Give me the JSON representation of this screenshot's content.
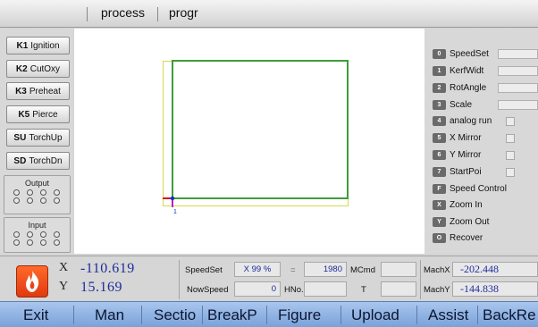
{
  "tabs": [
    "process",
    "progr"
  ],
  "left_buttons": [
    {
      "key": "K1",
      "label": "Ignition"
    },
    {
      "key": "K2",
      "label": "CutOxy"
    },
    {
      "key": "K3",
      "label": "Preheat"
    },
    {
      "key": "K5",
      "label": "Pierce"
    },
    {
      "key": "SU",
      "label": "TorchUp"
    },
    {
      "key": "SD",
      "label": "TorchDn"
    }
  ],
  "output_title": "Output",
  "input_title": "Input",
  "canvas_marker": "1",
  "right_items": [
    {
      "key": "0",
      "label": "SpeedSet",
      "control": "field"
    },
    {
      "key": "1",
      "label": "KerfWidt",
      "control": "field"
    },
    {
      "key": "2",
      "label": "RotAngle",
      "control": "field"
    },
    {
      "key": "3",
      "label": "Scale",
      "control": "field"
    },
    {
      "key": "4",
      "label": "analog run",
      "control": "check"
    },
    {
      "key": "5",
      "label": "X Mirror",
      "control": "check"
    },
    {
      "key": "6",
      "label": "Y Mirror",
      "control": "check"
    },
    {
      "key": "7",
      "label": "StartPoi",
      "control": "check"
    },
    {
      "key": "F",
      "label": "Speed Control",
      "control": "none"
    },
    {
      "key": "X",
      "label": "Zoom In",
      "control": "none"
    },
    {
      "key": "Y",
      "label": "Zoom Out",
      "control": "none"
    },
    {
      "key": "O",
      "label": "Recover",
      "control": "none"
    }
  ],
  "status": {
    "x_axis": "X",
    "y_axis": "Y",
    "x_value": "-110.619",
    "y_value": "15.169",
    "speedset_label": "SpeedSet",
    "x_pct_label": "X 99 %",
    "equals": "=",
    "speed_value": "1980",
    "mcmd_label": "MCmd",
    "mcmd_value": "",
    "nowspeed_label": "NowSpeed",
    "nowspeed_value": "0",
    "hno_label": "HNo.",
    "hno_value": "",
    "t_label": "T",
    "t_value": "",
    "machx_label": "MachX",
    "machx_value": "-202.448",
    "machy_label": "MachY",
    "machy_value": "-144.838"
  },
  "menu": [
    "Exit",
    "Man",
    "Sectio",
    "BreakP",
    "Figure",
    "Upload",
    "Assist",
    "BackRe"
  ],
  "colors": {
    "menu_bar": "#8fb2e3",
    "coordinate_text": "#1e2d9a",
    "path_green": "#3f9c3a",
    "bounds_yellow": "#d8d84a",
    "fire_icon": "#e8461a"
  }
}
